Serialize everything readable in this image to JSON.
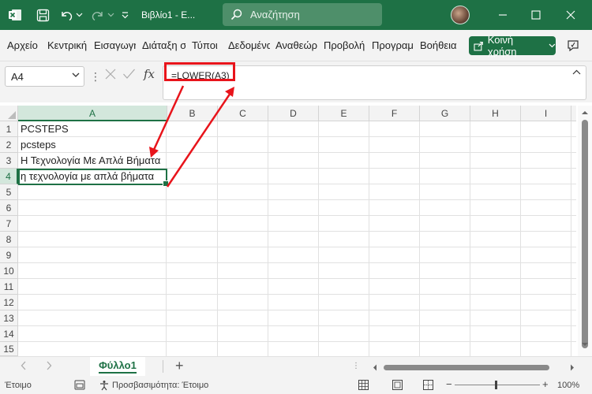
{
  "titlebar": {
    "title": "Βιβλίο1 - E...",
    "search_placeholder": "Αναζήτηση",
    "bg_color": "#1e7145"
  },
  "menu": {
    "items": [
      "Αρχείο",
      "Κεντρική",
      "Εισαγωγή",
      "Διάταξη σελίδας",
      "Τύποι",
      "Δεδομένα",
      "Αναθεώρηση",
      "Προβολή",
      "Προγραμματιστής",
      "Βοήθεια"
    ],
    "share_label": "Κοινή χρήση"
  },
  "formula_bar": {
    "name_box": "A4",
    "fx_label": "fx",
    "formula": "=LOWER(A3)",
    "highlight_color": "#e8141b"
  },
  "grid": {
    "columns": [
      "A",
      "B",
      "C",
      "D",
      "E",
      "F",
      "G",
      "H",
      "I"
    ],
    "rows": [
      "1",
      "2",
      "3",
      "4",
      "5",
      "6",
      "7",
      "8",
      "9",
      "10",
      "11",
      "12",
      "13",
      "14",
      "15"
    ],
    "selected_column": "A",
    "selected_row": "4",
    "cells": [
      {
        "ref": "A1",
        "value": "PCSTEPS"
      },
      {
        "ref": "A2",
        "value": "pcsteps"
      },
      {
        "ref": "A3",
        "value": "Η Τεχνολογία Με Απλά Βήματα"
      },
      {
        "ref": "A4",
        "value": "η τεχνολογία με απλά βήματα"
      }
    ],
    "active_cell": "A4"
  },
  "sheets": {
    "tabs": [
      "Φύλλο1"
    ],
    "active": "Φύλλο1",
    "add_label": "+"
  },
  "status": {
    "ready": "Έτοιμο",
    "accessibility": "Προσβασιμότητα: Έτοιμο",
    "zoom": "100%"
  },
  "icons": {
    "app": "excel-icon",
    "save": "save-icon",
    "undo": "undo-icon",
    "redo": "redo-icon",
    "search": "search-icon",
    "minimize": "minimize-icon",
    "maximize": "maximize-icon",
    "close": "close-icon",
    "comment": "comment-icon"
  }
}
